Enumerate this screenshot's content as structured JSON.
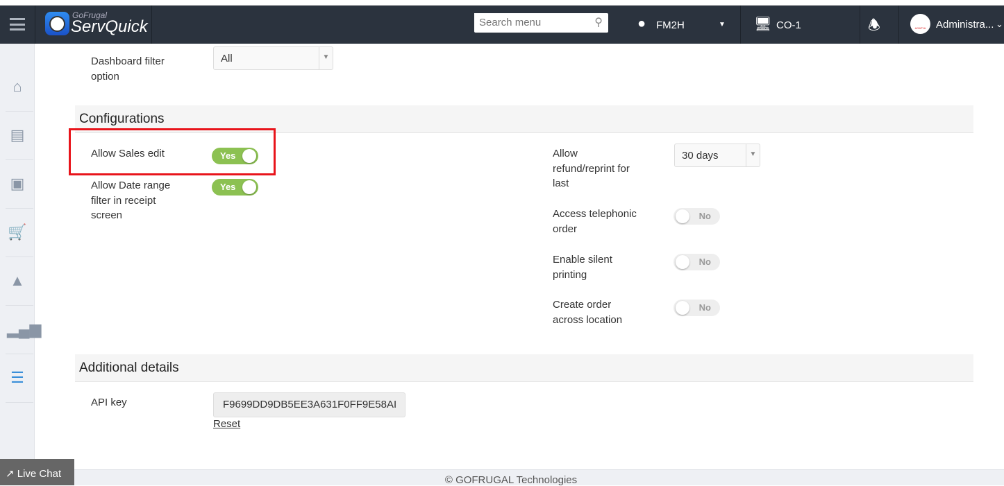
{
  "header": {
    "brand_top": "GoFrugal",
    "brand": "ServQuick",
    "search_placeholder": "Search menu",
    "location": "FM2H",
    "counter": "CO-1",
    "user": "Administra...",
    "avatar_text": "AGATYA"
  },
  "sidebar": {
    "items": [
      "home",
      "orders",
      "delivery",
      "cart",
      "kitchen",
      "reports",
      "settings"
    ],
    "active": "settings",
    "active_color": "#3a8fd9"
  },
  "dashboard": {
    "label": "Dashboard filter option",
    "value": "All"
  },
  "configurations": {
    "title": "Configurations",
    "left": [
      {
        "label": "Allow Sales edit",
        "state": "Yes",
        "on": true
      },
      {
        "label": "Allow Date range filter in receipt screen",
        "state": "Yes",
        "on": true
      }
    ],
    "refund": {
      "label": "Allow refund/reprint for last",
      "value": "30 days"
    },
    "right": [
      {
        "label": "Access telephonic order",
        "state": "No",
        "on": false
      },
      {
        "label": "Enable silent printing",
        "state": "No",
        "on": false
      },
      {
        "label": "Create order across location",
        "state": "No",
        "on": false
      }
    ]
  },
  "additional": {
    "title": "Additional details",
    "api_label": "API key",
    "api_value": "F9699DD9DB5EE3A631F0FF9E58AI",
    "reset": "Reset"
  },
  "live_chat": "Live Chat",
  "footer": "© GOFRUGAL Technologies",
  "highlight_color": "#e8141b"
}
